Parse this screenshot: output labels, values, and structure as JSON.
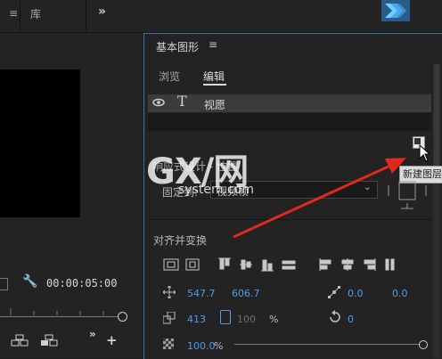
{
  "topbar": {
    "item1": "≡",
    "item2": "库",
    "more": "»"
  },
  "left_panel": {
    "timecode": "00:00:05:00",
    "more": "»",
    "add": "+"
  },
  "essential_graphics": {
    "title": "基本图形",
    "menu": "≡",
    "tabs": [
      {
        "label": "浏览"
      },
      {
        "label": "编辑"
      }
    ],
    "layer": {
      "name": "视愿"
    },
    "tooltip": "新建图层",
    "responsive_design_label": "响应式设计 - 位置",
    "pin_to_label": "固定到:",
    "pin_to_value": "视频帧",
    "align_transform_label": "对齐并变换",
    "position": {
      "x": "547.7",
      "y": "606.7"
    },
    "anchor": {
      "x": "0.0",
      "y": "0.0"
    },
    "scale": {
      "value": "413",
      "locked_value": "100",
      "unit": "%"
    },
    "rotation": "0",
    "opacity": {
      "value": "100.0",
      "unit": "%"
    }
  },
  "watermark": {
    "text": "GX/网",
    "sub": "system.com"
  },
  "colors": {
    "accent": "#4f9ce8",
    "arrow": "#e0281e",
    "panel_border": "#3f6fb0"
  }
}
